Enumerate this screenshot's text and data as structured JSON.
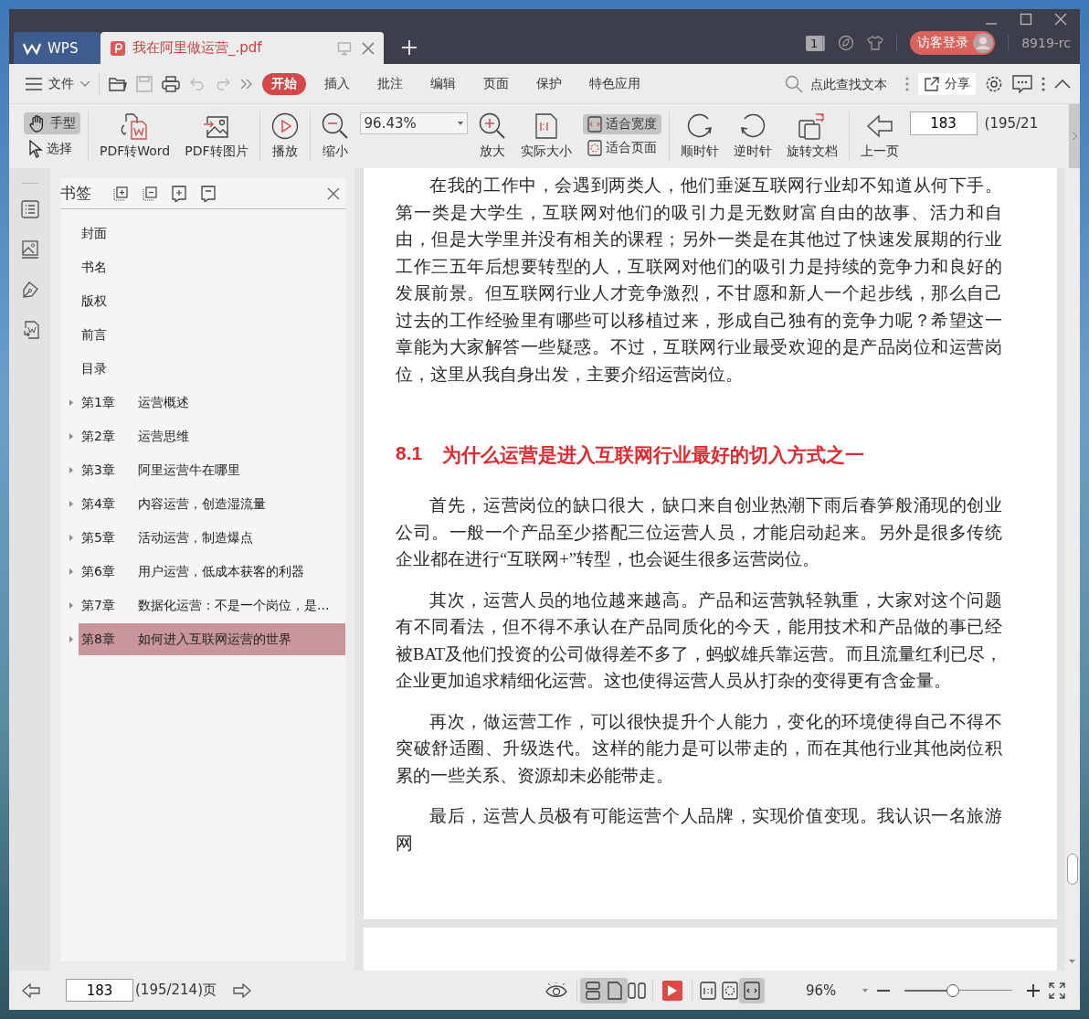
{
  "title_bar": {
    "tabs": [
      {
        "label": "WPS",
        "kind": "home",
        "selected": false
      },
      {
        "label": "我在阿里做运营_.pdf",
        "kind": "document",
        "selected": true
      }
    ],
    "badge": "1",
    "login_button": "访客登录",
    "user": "8919-rc"
  },
  "menu": {
    "file": "文件",
    "tabs": [
      {
        "label": "开始",
        "selected": true
      },
      {
        "label": "插入",
        "selected": false
      },
      {
        "label": "批注",
        "selected": false
      },
      {
        "label": "编辑",
        "selected": false
      },
      {
        "label": "页面",
        "selected": false
      },
      {
        "label": "保护",
        "selected": false
      },
      {
        "label": "特色应用",
        "selected": false
      }
    ],
    "search": {
      "placeholder": "点此查找文本"
    },
    "share": "分享"
  },
  "toolbar": {
    "hand": {
      "label": "手型",
      "selected": true
    },
    "select": {
      "label": "选择",
      "selected": false
    },
    "pdf_to_word": "PDF转Word",
    "pdf_to_image": "PDF转图片",
    "play": "播放",
    "zoom_out": "缩小",
    "zoom_value": "96.43%",
    "zoom_in": "放大",
    "actual_size": "实际大小",
    "fit_width": {
      "label": "适合宽度",
      "selected": true
    },
    "fit_page": {
      "label": "适合页面",
      "selected": false
    },
    "rotate_cw": "顺时针",
    "rotate_ccw": "逆时针",
    "rotate_doc": "旋转文档",
    "prev_page": "上一页",
    "page_value": "183",
    "page_count": "(195/21"
  },
  "bookmarks": {
    "title": "书签",
    "items": [
      {
        "label": "封面",
        "expandable": false,
        "selected": false
      },
      {
        "label": "书名",
        "expandable": false,
        "selected": false
      },
      {
        "label": "版权",
        "expandable": false,
        "selected": false
      },
      {
        "label": "前言",
        "expandable": false,
        "selected": false
      },
      {
        "label": "目录",
        "expandable": false,
        "selected": false
      },
      {
        "number": "第1章",
        "label": "运营概述",
        "expandable": true,
        "selected": false
      },
      {
        "number": "第2章",
        "label": "运营思维",
        "expandable": true,
        "selected": false
      },
      {
        "number": "第3章",
        "label": "阿里运营牛在哪里",
        "expandable": true,
        "selected": false
      },
      {
        "number": "第4章",
        "label": "内容运营，创造湿流量",
        "expandable": true,
        "selected": false
      },
      {
        "number": "第5章",
        "label": "活动运营，制造爆点",
        "expandable": true,
        "selected": false
      },
      {
        "number": "第6章",
        "label": "用户运营，低成本获客的利器",
        "expandable": true,
        "selected": false
      },
      {
        "number": "第7章",
        "label": "数据化运营：不是一个岗位，是...",
        "expandable": true,
        "selected": false
      },
      {
        "number": "第8章",
        "label": "如何进入互联网运营的世界",
        "expandable": true,
        "selected": true
      }
    ]
  },
  "document": {
    "blocks": [
      {
        "kind": "paragraph",
        "text": "在我的工作中，会遇到两类人，他们垂涎互联网行业却不知道从何下手。第一类是大学生，互联网对他们的吸引力是无数财富自由的故事、活力和自由，但是大学里并没有相关的课程；另外一类是在其他过了快速发展期的行业工作三五年后想要转型的人，互联网对他们的吸引力是持续的竞争力和良好的发展前景。但互联网行业人才竞争激烈，不甘愿和新人一个起步线，那么自己过去的工作经验里有哪些可以移植过来，形成自己独有的竞争力呢？希望这一章能为大家解答一些疑惑。不过，互联网行业最受欢迎的是产品岗位和运营岗位，这里从我自身出发，主要介绍运营岗位。"
      },
      {
        "kind": "heading",
        "number": "8.1",
        "text": "为什么运营是进入互联网行业最好的切入方式之一"
      },
      {
        "kind": "paragraph",
        "text": "首先，运营岗位的缺口很大，缺口来自创业热潮下雨后春笋般涌现的创业公司。一般一个产品至少搭配三位运营人员，才能启动起来。另外是很多传统企业都在进行“互联网+”转型，也会诞生很多运营岗位。"
      },
      {
        "kind": "paragraph",
        "text": "其次，运营人员的地位越来越高。产品和运营孰轻孰重，大家对这个问题有不同看法，但不得不承认在产品同质化的今天，能用技术和产品做的事已经被BAT及他们投资的公司做得差不多了，蚂蚁雄兵靠运营。而且流量红利已尽，企业更加追求精细化运营。这也使得运营人员从打杂的变得更有含金量。"
      },
      {
        "kind": "paragraph",
        "text": "再次，做运营工作，可以很快提升个人能力，变化的环境使得自己不得不突破舒适圈、升级迭代。这样的能力是可以带走的，而在其他行业其他岗位积累的一些关系、资源却未必能带走。"
      },
      {
        "kind": "paragraph",
        "text": "最后，运营人员极有可能运营个人品牌，实现价值变现。我认识一名旅游网"
      }
    ]
  },
  "status_bar": {
    "page_value": "183",
    "page_count": "(195/214)页",
    "view_modes": [
      {
        "kind": "continuous",
        "selected": true
      },
      {
        "kind": "single",
        "selected": true
      },
      {
        "kind": "double",
        "selected": false
      }
    ],
    "fit_modes": [
      {
        "kind": "actual",
        "selected": false
      },
      {
        "kind": "page",
        "selected": false
      },
      {
        "kind": "width",
        "selected": true
      }
    ],
    "zoom": "96%",
    "zoom_slider": {
      "level": 0.45
    }
  }
}
